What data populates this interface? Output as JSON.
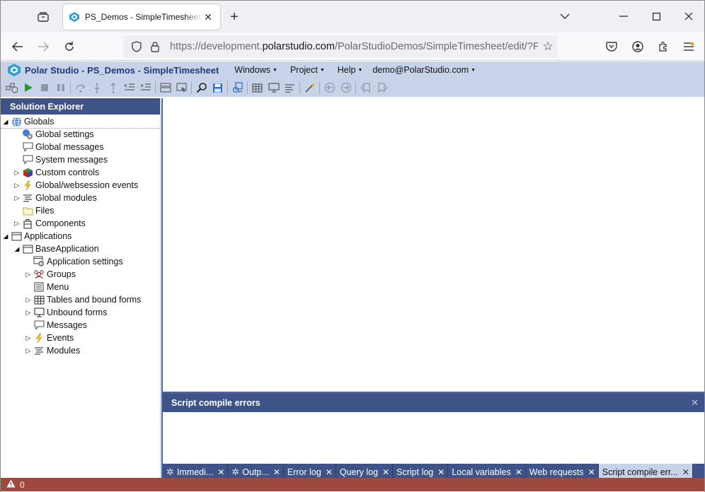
{
  "browser": {
    "tab_title": "PS_Demos - SimpleTimesheet - Polar Studio",
    "url_prefix": "https://development.",
    "url_host": "polarstudio.com",
    "url_path": "/PolarStudioDemos/SimpleTimesheet/edit/?PAGE"
  },
  "app": {
    "title": "Polar Studio - PS_Demos - SimpleTimesheet",
    "menus": [
      "Windows",
      "Project",
      "Help",
      "demo@PolarStudio.com"
    ]
  },
  "explorer": {
    "title": "Solution Explorer",
    "tree": {
      "globals": "Globals",
      "global_settings": "Global settings",
      "global_messages": "Global messages",
      "system_messages": "System messages",
      "custom_controls": "Custom controls",
      "global_websession_events": "Global/websession events",
      "global_modules": "Global modules",
      "files": "Files",
      "components": "Components",
      "applications": "Applications",
      "base_application": "BaseApplication",
      "application_settings": "Application settings",
      "groups": "Groups",
      "menu": "Menu",
      "tables_bound_forms": "Tables and bound forms",
      "unbound_forms": "Unbound forms",
      "messages": "Messages",
      "events": "Events",
      "modules": "Modules"
    }
  },
  "error_panel": {
    "title": "Script compile errors"
  },
  "bottom_tabs": [
    "Immedi...",
    "Outp...",
    "Error log",
    "Query log",
    "Script log",
    "Local variables",
    "Web requests",
    "Script compile err..."
  ],
  "status": {
    "warning_count": "0"
  },
  "colors": {
    "accent": "#3e5387",
    "header_bg": "#c8d3ea",
    "status_bar": "#9c4a3f"
  }
}
